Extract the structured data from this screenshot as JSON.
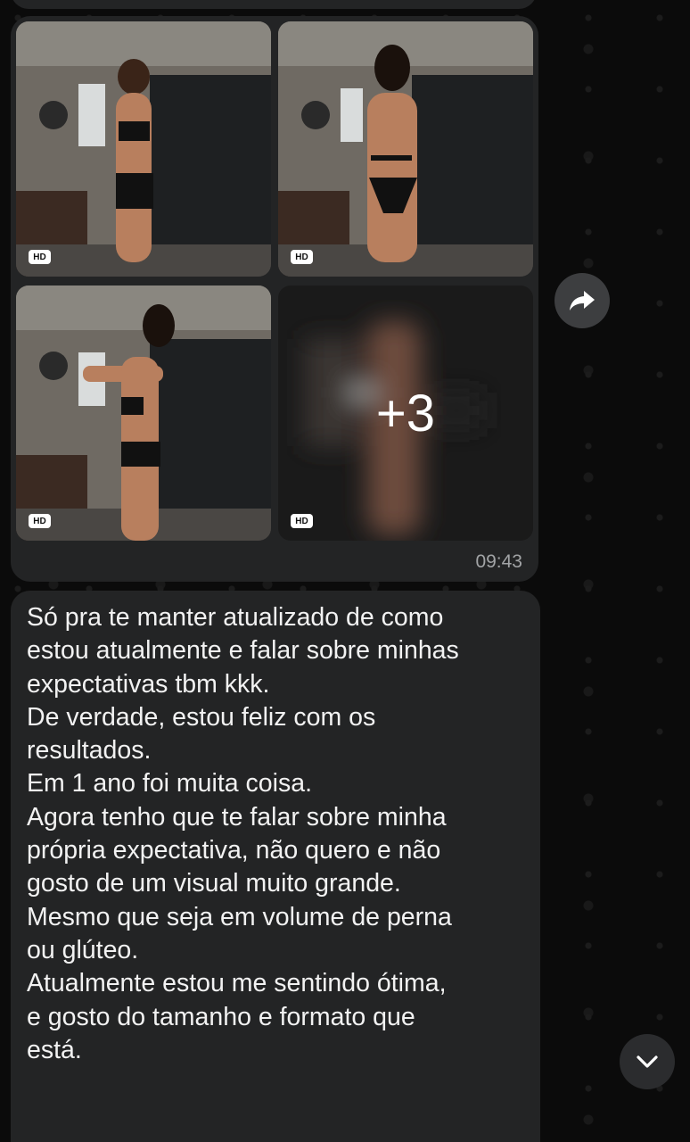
{
  "conversation": {
    "media_message": {
      "photos": [
        {
          "badge": "HD"
        },
        {
          "badge": "HD"
        },
        {
          "badge": "HD"
        },
        {
          "badge": "HD"
        }
      ],
      "more_count": "+3",
      "time": "09:43"
    },
    "text_message": {
      "text": "Só pra te manter atualizado de como\nestou atualmente e falar sobre minhas\nexpectativas tbm kkk.\nDe verdade, estou feliz com os\nresultados.\nEm 1 ano foi muita coisa.\nAgora tenho que te falar sobre minha\nprópria expectativa, não quero e não\ngosto de um visual muito grande.\nMesmo que seja em volume de perna\nou glúteo.\nAtualmente estou me sentindo ótima,\ne gosto do tamanho e formato que\nestá."
    }
  },
  "icons": {
    "forward": "forward-arrow-icon",
    "scroll": "chevron-down-icon"
  },
  "colors": {
    "background": "#0b0b0b",
    "bubble": "#232425",
    "text": "#f2f2f2",
    "timestamp": "#a2a4a6"
  }
}
